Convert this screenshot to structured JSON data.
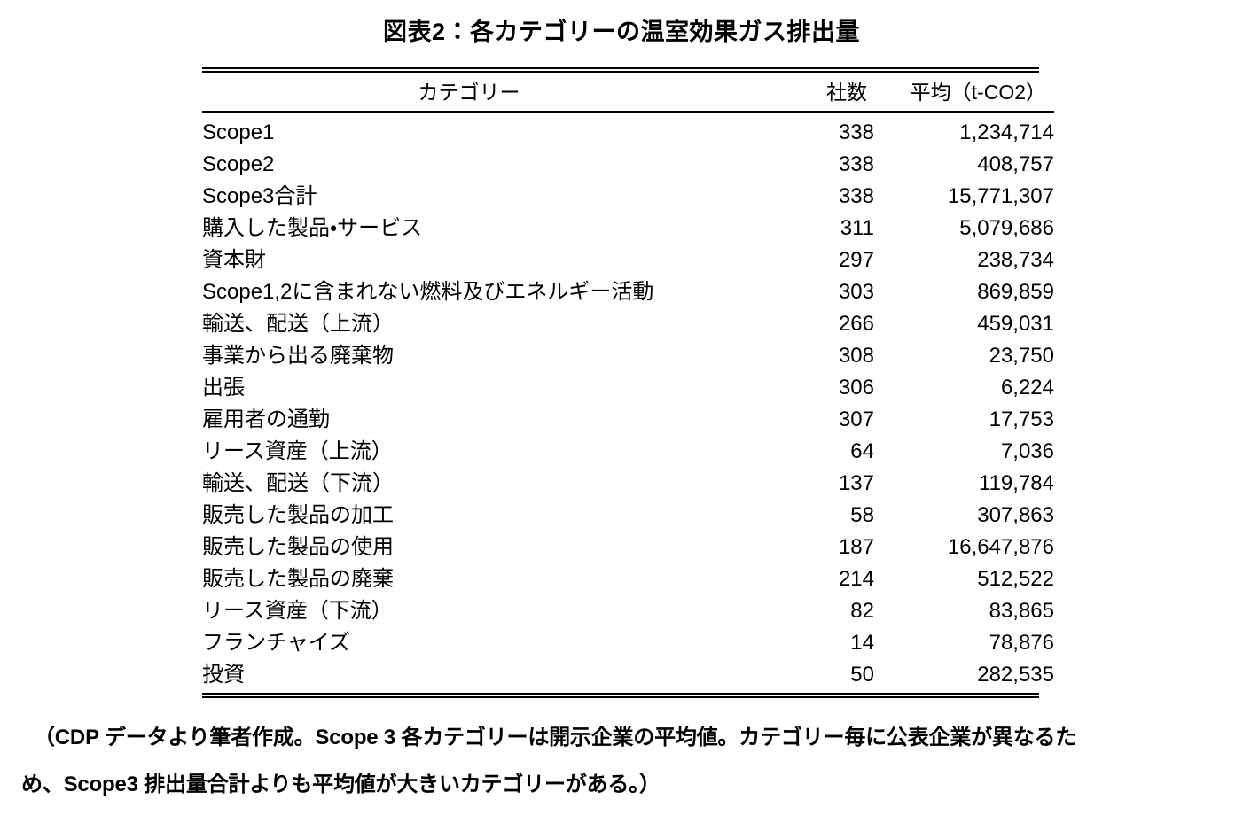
{
  "title": "図表2：各カテゴリーの温室効果ガス排出量",
  "table": {
    "headers": {
      "category": "カテゴリー",
      "count": "社数",
      "average": "平均（t-CO2）"
    },
    "rows": [
      {
        "category": "Scope1",
        "count": "338",
        "average": "1,234,714"
      },
      {
        "category": "Scope2",
        "count": "338",
        "average": "408,757"
      },
      {
        "category": "Scope3合計",
        "count": "338",
        "average": "15,771,307"
      },
      {
        "category": "購入した製品・サービス",
        "count": "311",
        "average": "5,079,686"
      },
      {
        "category": "資本財",
        "count": "297",
        "average": "238,734"
      },
      {
        "category": "Scope1,2に含まれない燃料及びエネルギー活動",
        "count": "303",
        "average": "869,859"
      },
      {
        "category": "輸送、配送（上流）",
        "count": "266",
        "average": "459,031"
      },
      {
        "category": "事業から出る廃棄物",
        "count": "308",
        "average": "23,750"
      },
      {
        "category": "出張",
        "count": "306",
        "average": "6,224"
      },
      {
        "category": "雇用者の通勤",
        "count": "307",
        "average": "17,753"
      },
      {
        "category": "リース資産（上流）",
        "count": "64",
        "average": "7,036"
      },
      {
        "category": "輸送、配送（下流）",
        "count": "137",
        "average": "119,784"
      },
      {
        "category": "販売した製品の加工",
        "count": "58",
        "average": "307,863"
      },
      {
        "category": "販売した製品の使用",
        "count": "187",
        "average": "16,647,876"
      },
      {
        "category": "販売した製品の廃棄",
        "count": "214",
        "average": "512,522"
      },
      {
        "category": "リース資産（下流）",
        "count": "82",
        "average": "83,865"
      },
      {
        "category": "フランチャイズ",
        "count": "14",
        "average": "78,876"
      },
      {
        "category": "投資",
        "count": "50",
        "average": "282,535"
      }
    ]
  },
  "footnote": {
    "line1": "（CDP データより筆者作成。Scope 3 各カテゴリーは開示企業の平均値。カテゴリー毎に公表企業が異なるた",
    "line2": "め、Scope3 排出量合計よりも平均値が大きいカテゴリーがある。）"
  },
  "chart_data": {
    "type": "table",
    "title": "図表2：各カテゴリーの温室効果ガス排出量",
    "columns": [
      "カテゴリー",
      "社数",
      "平均（t-CO2）"
    ],
    "categories": [
      "Scope1",
      "Scope2",
      "Scope3合計",
      "購入した製品・サービス",
      "資本財",
      "Scope1,2に含まれない燃料及びエネルギー活動",
      "輸送、配送（上流）",
      "事業から出る廃棄物",
      "出張",
      "雇用者の通勤",
      "リース資産（上流）",
      "輸送、配送（下流）",
      "販売した製品の加工",
      "販売した製品の使用",
      "販売した製品の廃棄",
      "リース資産（下流）",
      "フランチャイズ",
      "投資"
    ],
    "series": [
      {
        "name": "社数",
        "values": [
          338,
          338,
          338,
          311,
          297,
          303,
          266,
          308,
          306,
          307,
          64,
          137,
          58,
          187,
          214,
          82,
          14,
          50
        ]
      },
      {
        "name": "平均（t-CO2）",
        "values": [
          1234714,
          408757,
          15771307,
          5079686,
          238734,
          869859,
          459031,
          23750,
          6224,
          17753,
          7036,
          119784,
          307863,
          16647876,
          512522,
          83865,
          78876,
          282535
        ]
      }
    ]
  }
}
